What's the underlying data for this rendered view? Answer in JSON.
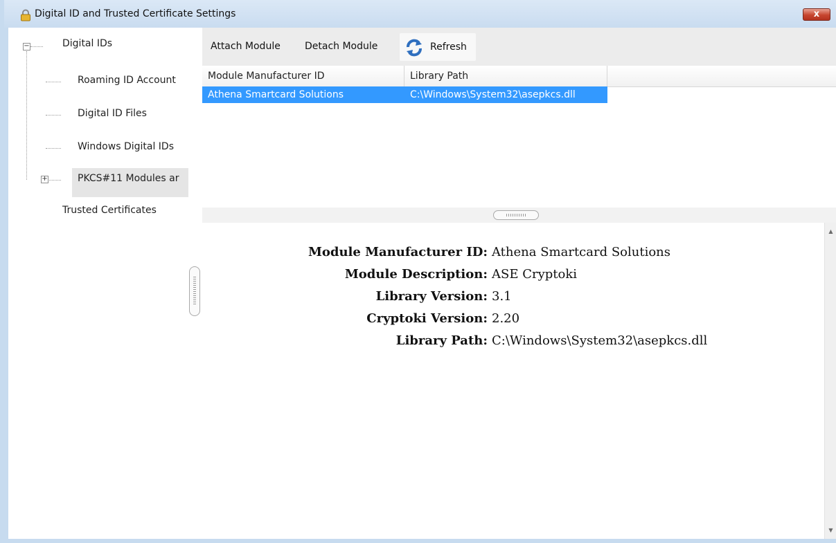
{
  "window": {
    "title": "Digital ID and Trusted Certificate Settings",
    "close_label": "x"
  },
  "tree": {
    "root_label": "Digital IDs",
    "root_expander": "−",
    "children": [
      {
        "label": "Roaming ID Account"
      },
      {
        "label": "Digital ID Files"
      },
      {
        "label": "Windows Digital IDs"
      },
      {
        "label": "PKCS#11 Modules ar",
        "expander": "+"
      }
    ],
    "trusted_label": "Trusted Certificates"
  },
  "toolbar": {
    "attach_label": "Attach Module",
    "detach_label": "Detach Module",
    "refresh_label": "Refresh"
  },
  "table": {
    "columns": [
      "Module Manufacturer ID",
      "Library Path"
    ],
    "rows": [
      [
        "Athena Smartcard Solutions",
        "C:\\Windows\\System32\\asepkcs.dll"
      ]
    ]
  },
  "details": [
    {
      "label": "Module Manufacturer ID:",
      "value": "Athena Smartcard Solutions"
    },
    {
      "label": "Module Description:",
      "value": "ASE Cryptoki"
    },
    {
      "label": "Library Version:",
      "value": "3.1"
    },
    {
      "label": "Cryptoki Version:",
      "value": "2.20"
    },
    {
      "label": "Library Path:",
      "value": "C:\\Windows\\System32\\asepkcs.dll"
    }
  ],
  "colors": {
    "selection": "#3399ff",
    "title_bar": "#c9dcf0",
    "close_button": "#c7452f"
  },
  "icons": {
    "title": "lock-icon",
    "refresh": "refresh-icon"
  }
}
